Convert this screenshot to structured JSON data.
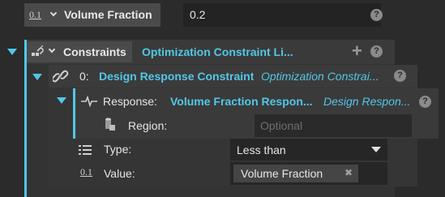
{
  "volume_fraction_row": {
    "icon_text": "0.1",
    "label": "Volume Fraction",
    "value": "0.2",
    "help": "?"
  },
  "constraints": {
    "label": "Constraints",
    "list_title": "Optimization Constraint Li...",
    "add": "+",
    "help": "?"
  },
  "design_response_constraint": {
    "index": "0:",
    "title": "Design Response Constraint",
    "type_title": "Optimization Constrai...",
    "help": "?"
  },
  "response": {
    "label": "Response:",
    "value": "Volume Fraction Respon...",
    "type_title": "Design Respon...",
    "help": "?"
  },
  "region": {
    "label": "Region:",
    "placeholder": "Optional"
  },
  "type_row": {
    "label": "Type:",
    "selected": "Less than"
  },
  "value_row": {
    "icon_text": "0.1",
    "label": "Value:",
    "chip": "Volume Fraction",
    "chip_remove": "✖"
  },
  "colors": {
    "accent": "#52c7e8",
    "background": "#2b2b2b",
    "panel": "#353535",
    "field": "#262626"
  }
}
